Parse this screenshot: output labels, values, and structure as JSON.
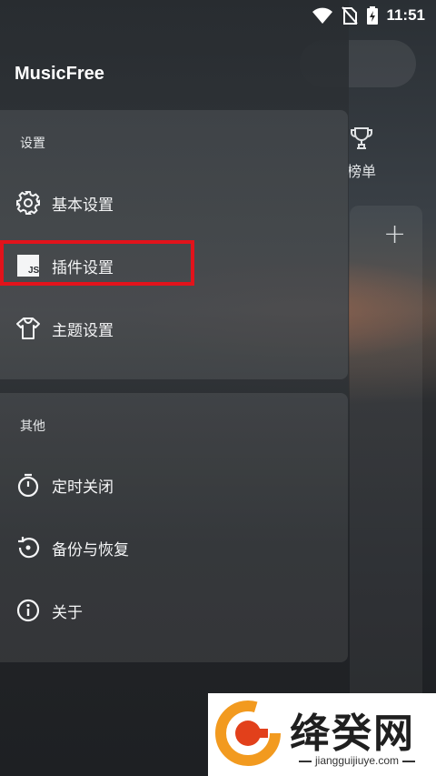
{
  "status_bar": {
    "time": "11:51"
  },
  "background": {
    "rank_label": "榜单"
  },
  "drawer": {
    "app_title": "MusicFree",
    "settings_section": {
      "label": "设置",
      "items": [
        {
          "label": "基本设置",
          "icon": "gear-icon"
        },
        {
          "label": "插件设置",
          "icon": "js-plugin-icon"
        },
        {
          "label": "主题设置",
          "icon": "tshirt-icon"
        }
      ]
    },
    "other_section": {
      "label": "其他",
      "items": [
        {
          "label": "定时关闭",
          "icon": "timer-icon"
        },
        {
          "label": "备份与恢复",
          "icon": "restore-icon"
        },
        {
          "label": "关于",
          "icon": "info-icon"
        }
      ]
    }
  },
  "watermark": {
    "name": "绛癸网",
    "url": "jiangguijiuye.com"
  },
  "colors": {
    "highlight": "#e2131b",
    "watermark_orange": "#f29a1f",
    "watermark_red": "#e2401b"
  }
}
